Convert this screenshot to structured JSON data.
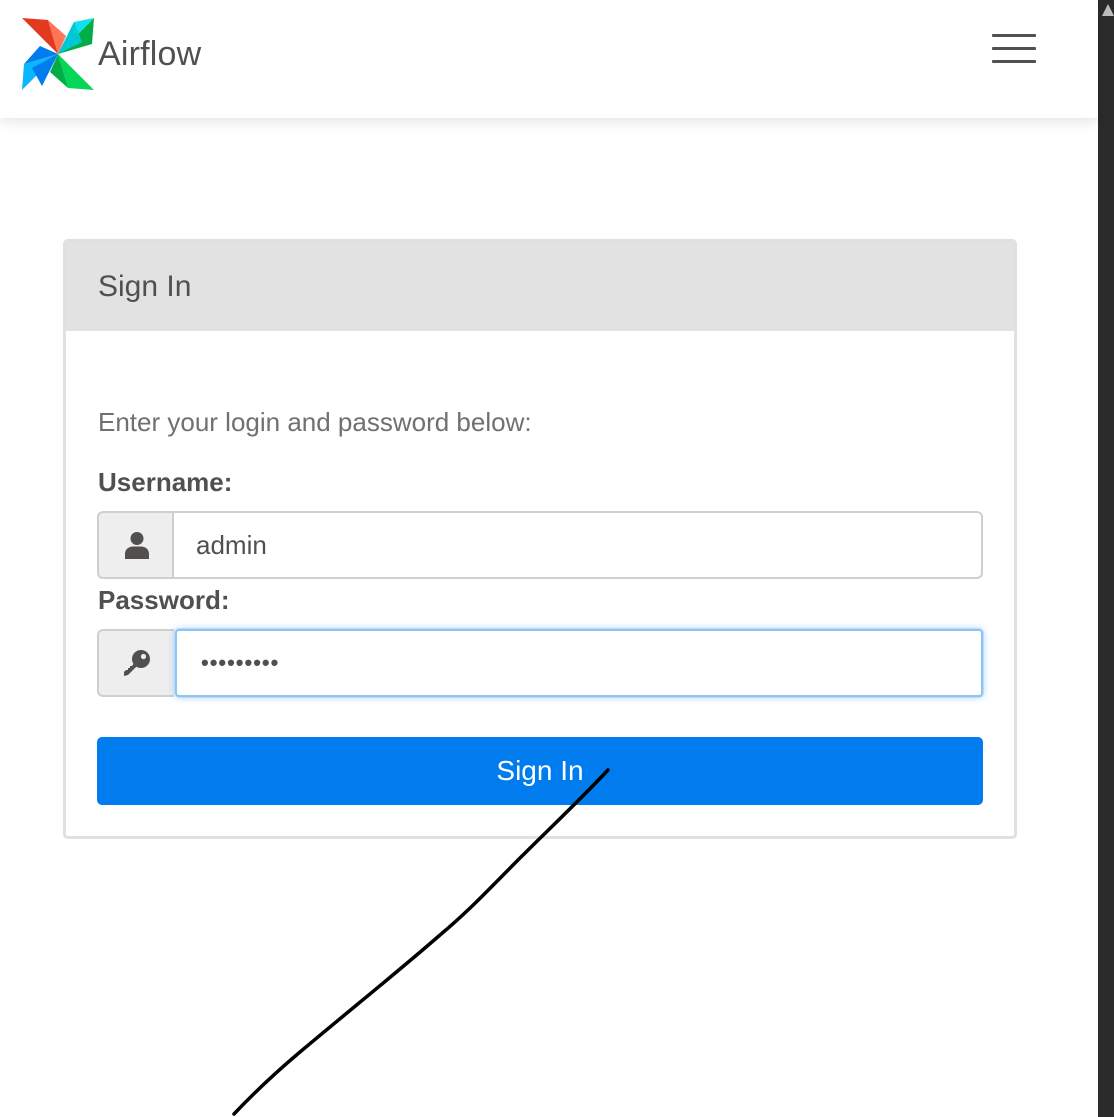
{
  "app": {
    "name": "Airflow"
  },
  "navbar": {
    "menu_icon": "hamburger-menu-icon"
  },
  "login": {
    "title": "Sign In",
    "intro": "Enter your login and password below:",
    "username_label": "Username:",
    "username_value": "admin",
    "username_icon": "user-icon",
    "password_label": "Password:",
    "password_value": "•••••••••",
    "password_icon": "key-icon",
    "submit_label": "Sign In"
  },
  "colors": {
    "primary": "#017cee",
    "header_bg": "#e2e2e2",
    "text": "#51504f",
    "focus_border": "#8ec5f0"
  }
}
